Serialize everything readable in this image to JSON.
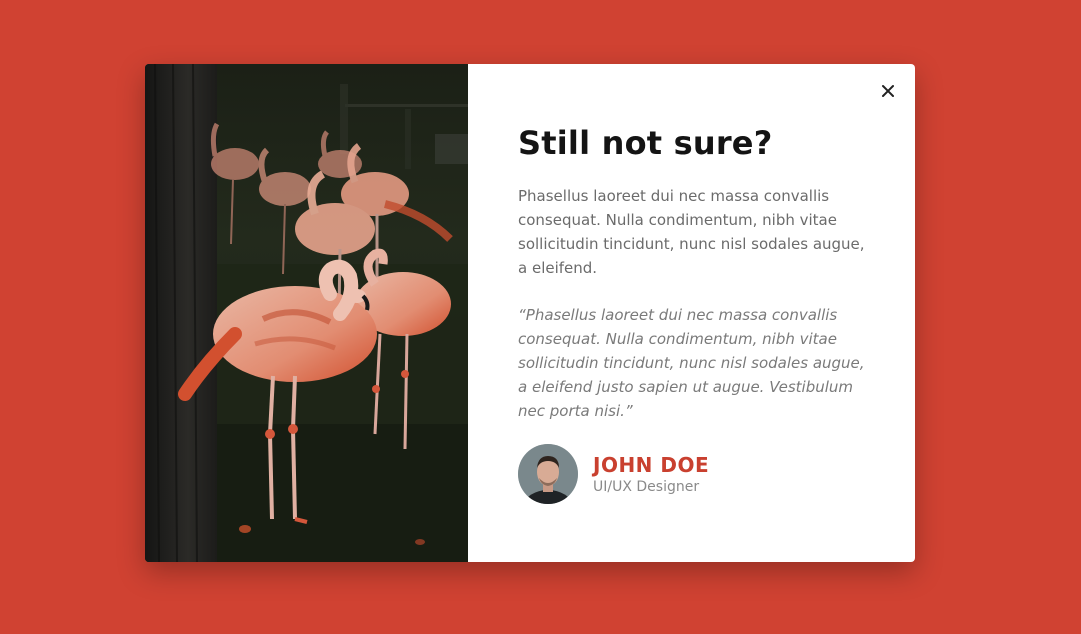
{
  "background_color": "#d04232",
  "accent_color": "#c9402f",
  "modal": {
    "image_alt": "flamingos-photo",
    "title": "Still not sure?",
    "body": "Phasellus laoreet dui nec massa convallis consequat. Nulla condimentum, nibh vitae sollicitudin tincidunt, nunc nisl sodales augue, a eleifend.",
    "quote": "“Phasellus laoreet dui nec massa convallis consequat. Nulla condimentum, nibh vitae sollicitudin tincidunt, nunc nisl sodales augue, a eleifend justo sapien ut augue. Vestibulum nec porta nisi.”",
    "close_icon": "close-icon",
    "author": {
      "name": "JOHN DOE",
      "role": "UI/UX Designer"
    }
  }
}
